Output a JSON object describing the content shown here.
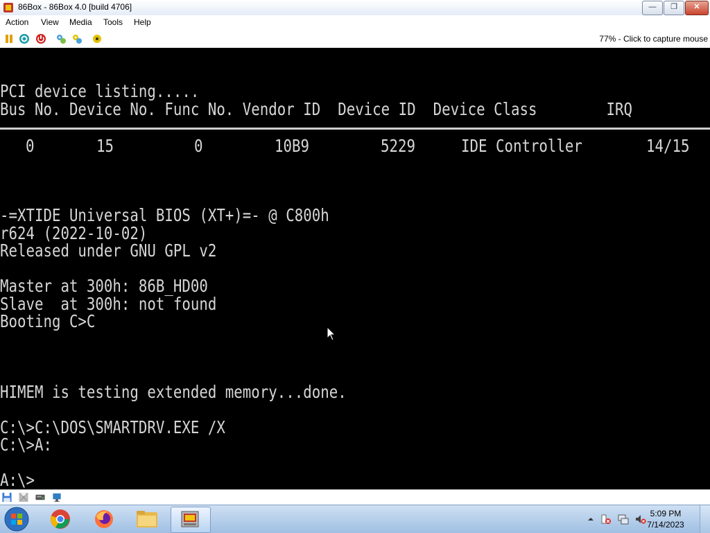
{
  "window": {
    "title": "86Box - 86Box 4.0 [build 4706]",
    "minimize": "—",
    "maximize": "❐",
    "close": "✕"
  },
  "menu": [
    "Action",
    "View",
    "Media",
    "Tools",
    "Help"
  ],
  "toolbar": {
    "icons": [
      "pause-icon",
      "reset-icon",
      "power-icon",
      "settings-icon",
      "ctrl-alt-del-icon",
      "ctrl-alt-esc-icon"
    ],
    "status": "77% - Click to capture mouse"
  },
  "screen": {
    "pci_title": "PCI device listing.....",
    "pci_header": "Bus No. Device No. Func No. Vendor ID  Device ID  Device Class        IRQ",
    "pci_row": {
      "bus": "0",
      "device": "15",
      "func": "0",
      "vendor": "10B9",
      "device_id": "5229",
      "class": "IDE Controller",
      "irq": "14/15"
    },
    "xtide_title": "-=XTIDE Universal BIOS (XT+)=- @ C800h",
    "xtide_version": "r624 (2022-10-02)",
    "xtide_license": "Released under GNU GPL v2",
    "master": "Master at 300h: 86B_HD00",
    "slave": "Slave  at 300h: not found",
    "booting": "Booting C>C",
    "himem": "HIMEM is testing extended memory...done.",
    "smartdrv": "C:\\>C:\\DOS\\SMARTDRV.EXE /X",
    "drive_a": "C:\\>A:",
    "prompt": "A:\\>"
  },
  "statusbar": {
    "icons": [
      "floppy-icon",
      "floppy-empty-icon",
      "hard-disk-icon",
      "network-icon"
    ]
  },
  "taskbar": {
    "apps": [
      "windows-start-icon",
      "chrome-icon",
      "firefox-icon",
      "file-explorer-icon",
      "86box-icon"
    ],
    "clock_time": "5:09 PM",
    "clock_date": "7/14/2023"
  },
  "colors": {
    "screen_bg": "#000000",
    "screen_text": "#d6d6d6",
    "taskbar": "#a9c6e8"
  }
}
